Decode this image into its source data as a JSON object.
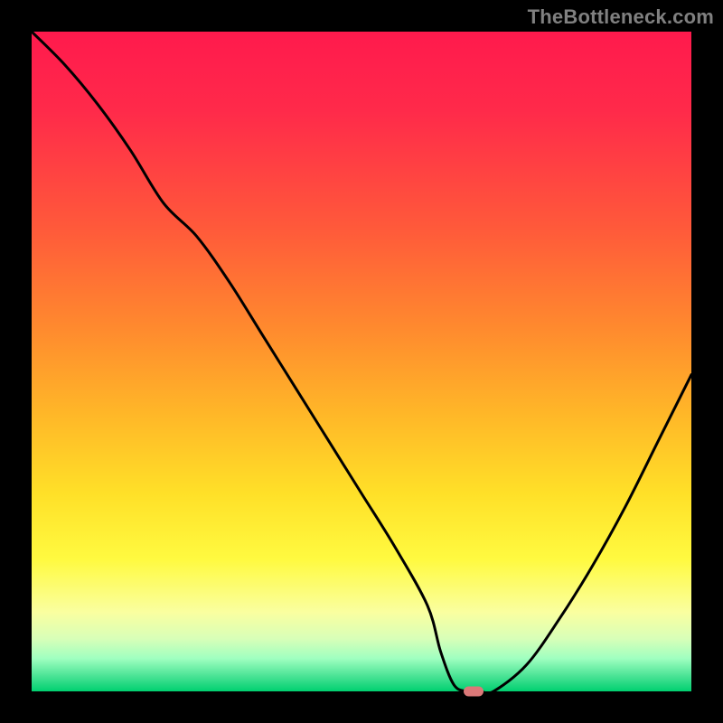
{
  "watermark": {
    "text": "TheBottleneck.com"
  },
  "colors": {
    "marker": "#db7878",
    "curve": "#000000",
    "background": "#000000"
  },
  "chart_data": {
    "type": "line",
    "title": "",
    "xlabel": "",
    "ylabel": "",
    "xlim": [
      0,
      100
    ],
    "ylim": [
      0,
      100
    ],
    "grid": false,
    "legend": false,
    "annotations": [
      "TheBottleneck.com"
    ],
    "marker": {
      "x": 67,
      "y": 0,
      "color": "#db7878"
    },
    "series": [
      {
        "name": "bottleneck-curve",
        "color": "#000000",
        "x": [
          0,
          5,
          10,
          15,
          20,
          25,
          30,
          35,
          40,
          45,
          50,
          55,
          60,
          62,
          64,
          66,
          68,
          70,
          75,
          80,
          85,
          90,
          95,
          100
        ],
        "y": [
          100,
          95,
          89,
          82,
          74,
          69,
          62,
          54,
          46,
          38,
          30,
          22,
          13,
          6,
          1,
          0,
          0,
          0,
          4,
          11,
          19,
          28,
          38,
          48
        ]
      }
    ]
  }
}
